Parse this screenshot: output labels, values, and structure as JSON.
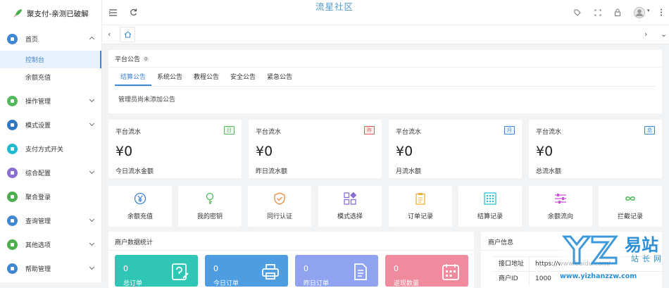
{
  "app": {
    "name": "聚支付-亲测已破解",
    "site_title": "流星社区"
  },
  "sidebar": {
    "items": [
      {
        "label": "首页",
        "color": "#3f86d3",
        "open": true
      },
      {
        "label": "操作管理",
        "color": "#53b85a"
      },
      {
        "label": "模式设置",
        "color": "#2f79c4"
      },
      {
        "label": "支付方式开关",
        "color": "#1fbad0"
      },
      {
        "label": "综合配置",
        "color": "#8a6fd1"
      },
      {
        "label": "聚合登录",
        "color": "#4cae4c"
      },
      {
        "label": "查询管理",
        "color": "#3f86d3"
      },
      {
        "label": "其他选项",
        "color": "#4cae4c"
      },
      {
        "label": "帮助管理",
        "color": "#3f86d3"
      }
    ],
    "subitems": [
      {
        "label": "控制台",
        "active": true
      },
      {
        "label": "余额充值"
      }
    ]
  },
  "notice": {
    "title": "平台公告",
    "count": "0",
    "tabs": [
      "结算公告",
      "系统公告",
      "教程公告",
      "安全公告",
      "紧急公告"
    ],
    "active_tab": 0,
    "empty_text": "管理员尚未添加公告"
  },
  "stats": [
    {
      "label": "平台流水",
      "badge": "日",
      "badge_color": "#53b85a",
      "value": "¥0",
      "desc": "今日流水金额"
    },
    {
      "label": "平台流水",
      "badge": "昨",
      "badge_color": "#e85555",
      "value": "¥0",
      "desc": "昨日流水额"
    },
    {
      "label": "平台流水",
      "badge": "月",
      "badge_color": "#3f86d3",
      "value": "¥0",
      "desc": "月流水额"
    },
    {
      "label": "平台流水",
      "badge": "总",
      "badge_color": "#3f86d3",
      "value": "¥0",
      "desc": "总流水额"
    }
  ],
  "quick_actions": [
    {
      "label": "余额充值",
      "icon": "yen-circle-icon",
      "color": "#3f86d3"
    },
    {
      "label": "我的密钥",
      "icon": "key-icon",
      "color": "#53b85a"
    },
    {
      "label": "同行认证",
      "icon": "shield-check-icon",
      "color": "#f0883a"
    },
    {
      "label": "模式选择",
      "icon": "grid-icon",
      "color": "#8a6fd1"
    },
    {
      "label": "订单记录",
      "icon": "clipboard-icon",
      "color": "#f0b030"
    },
    {
      "label": "结算记录",
      "icon": "dots-grid-icon",
      "color": "#1fbad0"
    },
    {
      "label": "余额流向",
      "icon": "sliders-icon",
      "color": "#c94fd6"
    },
    {
      "label": "拦截记录",
      "icon": "infinity-icon",
      "color": "#53b85a"
    }
  ],
  "merchant_stats": {
    "title": "商户数据统计",
    "boxes": [
      {
        "value": "0",
        "label": "总订单",
        "color": "#2fc6b5",
        "icon": "edit-doc-icon"
      },
      {
        "value": "0",
        "label": "今日订单",
        "color": "#4d9de0",
        "icon": "printer-icon"
      },
      {
        "value": "0",
        "label": "昨日订单",
        "color": "#8fa3f0",
        "icon": "document-icon"
      },
      {
        "value": "0",
        "label": "返现数量",
        "color": "#ef8b9c",
        "icon": "calendar-icon"
      }
    ]
  },
  "merchant_info": {
    "title": "商户信息",
    "rows": [
      {
        "key": "接口地址",
        "value": "https://www.baidu.com/"
      },
      {
        "key": "商户ID",
        "value": "1000"
      }
    ]
  },
  "watermark": {
    "brand": "易站",
    "sub": "站长网",
    "url": "www.yizhanzzw.com"
  }
}
